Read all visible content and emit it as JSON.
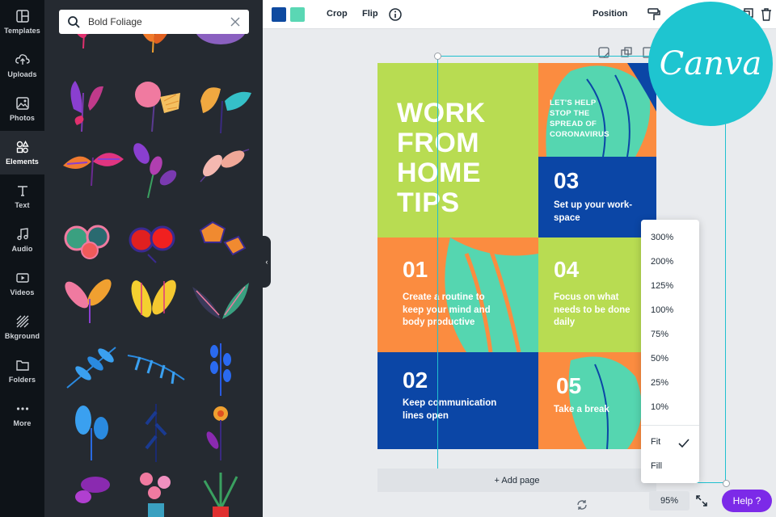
{
  "rail": {
    "items": [
      {
        "label": "Templates",
        "icon": "templates-icon"
      },
      {
        "label": "Uploads",
        "icon": "upload-icon"
      },
      {
        "label": "Photos",
        "icon": "photo-icon"
      },
      {
        "label": "Elements",
        "icon": "elements-icon",
        "active": true
      },
      {
        "label": "Text",
        "icon": "text-icon"
      },
      {
        "label": "Audio",
        "icon": "music-icon"
      },
      {
        "label": "Videos",
        "icon": "video-icon"
      },
      {
        "label": "Bkground",
        "icon": "background-icon"
      },
      {
        "label": "Folders",
        "icon": "folder-icon"
      },
      {
        "label": "More",
        "icon": "more-icon"
      }
    ]
  },
  "search": {
    "value": "Bold Foliage"
  },
  "toolbar": {
    "swatches": [
      "#0e4aa0",
      "#5ad7b4"
    ],
    "crop": "Crop",
    "flip": "Flip",
    "position": "Position"
  },
  "design": {
    "title": "WORK\nFROM\nHOME\nTIPS",
    "banner": "LET'S HELP\nSTOP THE\nSPREAD OF\nCORONAVIRUS",
    "tips": [
      {
        "num": "01",
        "text": "Create a routine to keep your mind and body productive"
      },
      {
        "num": "02",
        "text": "Keep communication lines open"
      },
      {
        "num": "03",
        "text": "Set up your work-space"
      },
      {
        "num": "04",
        "text": "Focus on what needs to be done daily"
      },
      {
        "num": "05",
        "text": "Take a break"
      }
    ],
    "colors": {
      "lime": "#b8dc52",
      "orange": "#fb8c40",
      "blue": "#0b46a6",
      "mint": "#55d6b0",
      "navy": "#0b3d8f"
    }
  },
  "add_page": "+ Add page",
  "zoom": {
    "options": [
      "300%",
      "200%",
      "125%",
      "100%",
      "75%",
      "50%",
      "25%",
      "10%"
    ],
    "fit": "Fit",
    "fill": "Fill",
    "selected": "Fit",
    "current": "95%"
  },
  "help": "Help ?",
  "logo": "Canva",
  "accent": "#1fc0cf"
}
